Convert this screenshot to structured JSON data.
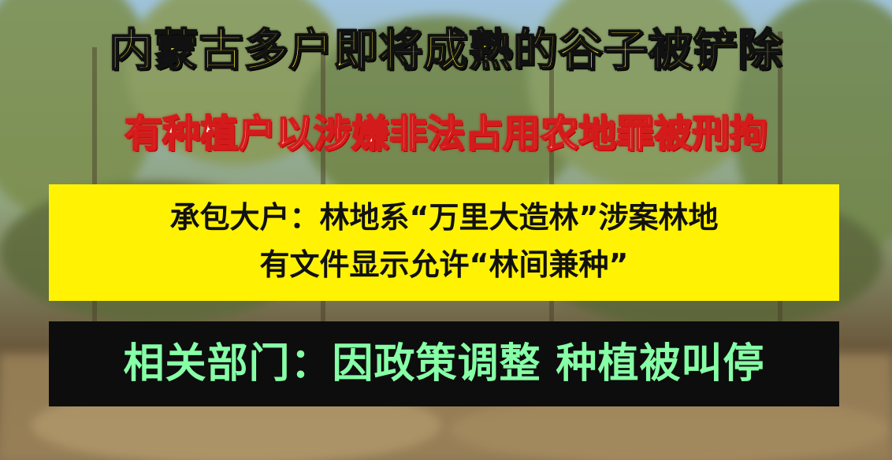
{
  "headline": "内蒙古多户即将成熟的谷子被铲除",
  "subheadline": "有种植户以涉嫌非法占用农地罪被刑拘",
  "statement_box": {
    "line1": "承包大户：林地系“万里大造林”涉案林地",
    "line2": "有文件显示允许“林间兼种”"
  },
  "official_box": {
    "text": "相关部门：因政策调整 种植被叫停"
  },
  "colors": {
    "headline_fill": "#fff231",
    "subheadline_stroke": "#d41b1b",
    "statement_bg": "#fff203",
    "official_bg": "#0d0d0d",
    "official_text": "#86ffa6"
  }
}
